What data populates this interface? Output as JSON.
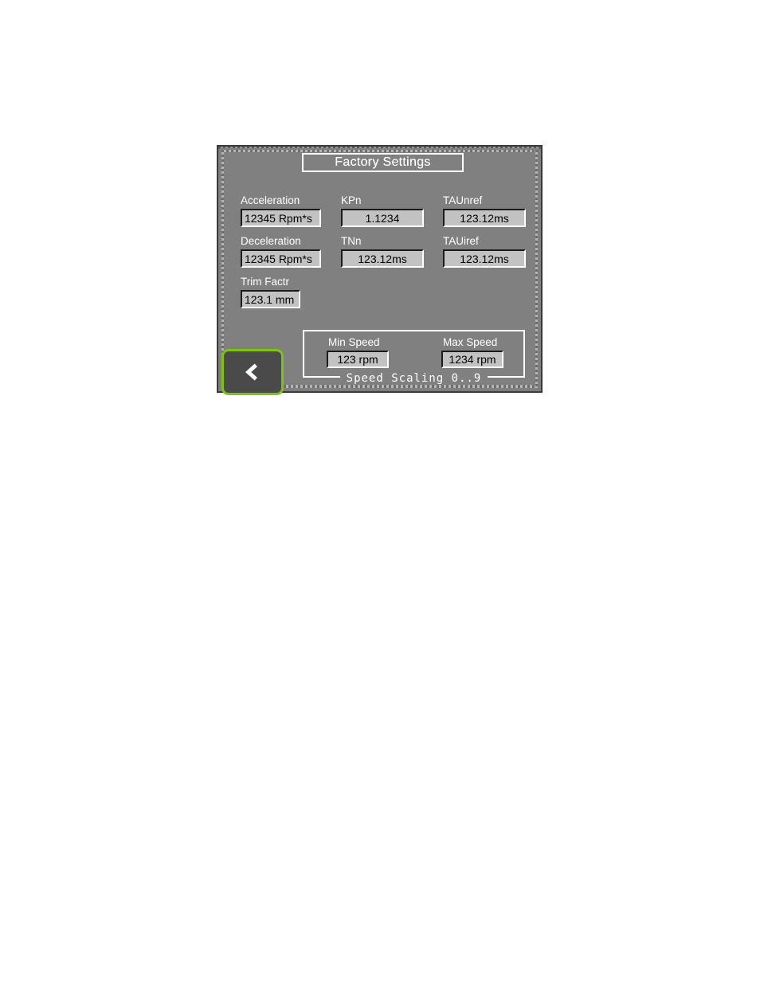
{
  "panel": {
    "title": "Factory Settings",
    "accent_green": "#7cc410",
    "panel_bg": "#808080",
    "field_bg": "#c2c2c2",
    "label_color": "#ffffff"
  },
  "fields": [
    {
      "id": "acceleration",
      "label": "Acceleration",
      "value": "12345 Rpm*s",
      "align": "left"
    },
    {
      "id": "deceleration",
      "label": "Deceleration",
      "value": "12345 Rpm*s",
      "align": "left"
    },
    {
      "id": "trim-factr",
      "label": "Trim Factr",
      "value": "123.1 mm",
      "align": "left"
    },
    {
      "id": "kpn",
      "label": "KPn",
      "value": "1.1234",
      "align": "center"
    },
    {
      "id": "tnn",
      "label": "TNn",
      "value": "123.12ms",
      "align": "center"
    },
    {
      "id": "taunref",
      "label": "TAUnref",
      "value": "123.12ms",
      "align": "center"
    },
    {
      "id": "tauiref",
      "label": "TAUiref",
      "value": "123.12ms",
      "align": "center"
    }
  ],
  "speed_scaling": {
    "legend": "Speed Scaling 0..9",
    "min": {
      "label": "Min Speed",
      "value": "123 rpm"
    },
    "max": {
      "label": "Max Speed",
      "value": "1234 rpm"
    }
  },
  "back_button": {
    "icon": "chevron-left-icon",
    "label": ""
  }
}
